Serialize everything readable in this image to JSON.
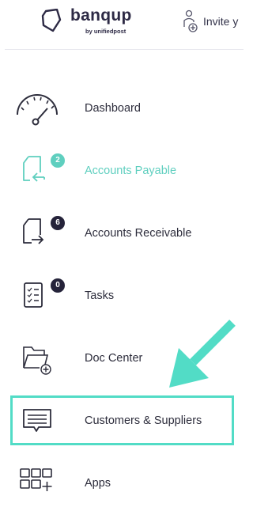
{
  "header": {
    "brand": "banqup",
    "brand_sub": "by unifiedpost",
    "invite_label": "Invite y"
  },
  "menu": {
    "items": [
      {
        "label": "Dashboard",
        "icon": "gauge-icon",
        "badge": ""
      },
      {
        "label": "Accounts Payable",
        "icon": "document-inbound-icon",
        "badge": "2",
        "active": true
      },
      {
        "label": "Accounts Receivable",
        "icon": "document-outbound-icon",
        "badge": "6"
      },
      {
        "label": "Tasks",
        "icon": "checklist-icon",
        "badge": "0"
      },
      {
        "label": "Doc Center",
        "icon": "folder-add-icon",
        "badge": ""
      },
      {
        "label": "Customers & Suppliers",
        "icon": "chat-list-icon",
        "badge": "",
        "highlighted": true
      },
      {
        "label": "Apps",
        "icon": "apps-grid-icon",
        "badge": ""
      }
    ]
  },
  "colors": {
    "accent": "#5fcfbf",
    "highlight": "#52dcc6",
    "badge": "#25233a",
    "text": "#2d2d3c"
  }
}
